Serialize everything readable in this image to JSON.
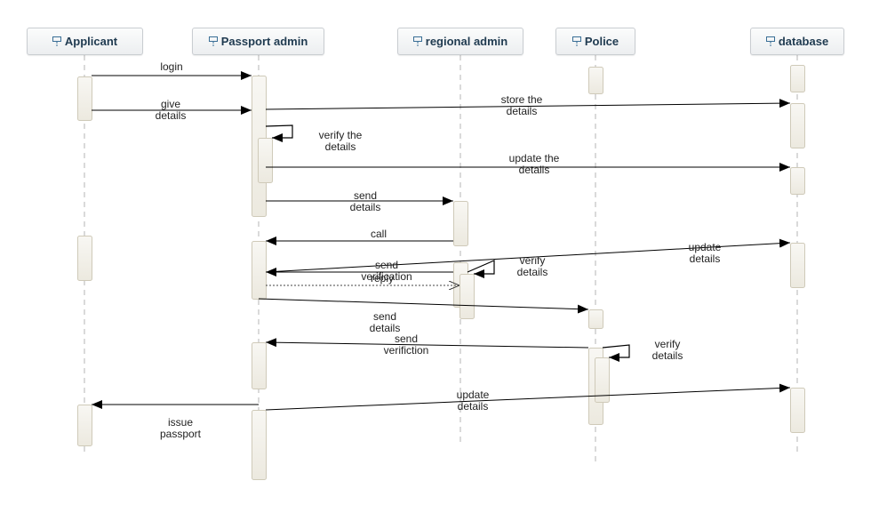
{
  "diagram": {
    "type": "sequence",
    "lifelines": [
      {
        "id": "applicant",
        "name": "Applicant"
      },
      {
        "id": "passport",
        "name": "Passport admin"
      },
      {
        "id": "regional",
        "name": "regional admin"
      },
      {
        "id": "police",
        "name": "Police"
      },
      {
        "id": "database",
        "name": "database"
      }
    ],
    "messages": [
      {
        "from": "applicant",
        "to": "passport",
        "label": "login",
        "kind": "sync"
      },
      {
        "from": "applicant",
        "to": "passport",
        "label": "give\ndetails",
        "kind": "sync"
      },
      {
        "from": "passport",
        "to": "database",
        "label": "store the\ndetails",
        "kind": "sync"
      },
      {
        "from": "passport",
        "to": "passport",
        "label": "verify the\ndetails",
        "kind": "self"
      },
      {
        "from": "passport",
        "to": "database",
        "label": "update the\ndetails",
        "kind": "sync"
      },
      {
        "from": "passport",
        "to": "regional",
        "label": "send\ndetails",
        "kind": "sync"
      },
      {
        "from": "regional",
        "to": "passport",
        "label": "call",
        "kind": "sync"
      },
      {
        "from": "regional",
        "to": "regional",
        "label": "verify\ndetails",
        "kind": "self"
      },
      {
        "from": "passport",
        "to": "database",
        "label": "update\ndetails",
        "kind": "sync"
      },
      {
        "from": "regional",
        "to": "passport",
        "label": "send\nverification",
        "kind": "sync"
      },
      {
        "from": "passport",
        "to": "regional",
        "label": "reply",
        "kind": "reply"
      },
      {
        "from": "passport",
        "to": "police",
        "label": "send\ndetails",
        "kind": "sync"
      },
      {
        "from": "police",
        "to": "passport",
        "label": "send\nverifiction",
        "kind": "sync"
      },
      {
        "from": "police",
        "to": "police",
        "label": "verify\ndetails",
        "kind": "self"
      },
      {
        "from": "passport",
        "to": "database",
        "label": "update\ndetails",
        "kind": "sync"
      },
      {
        "from": "passport",
        "to": "applicant",
        "label": "issue\npassport",
        "kind": "sync"
      }
    ]
  },
  "colors": {
    "header_text": "#1f3a50",
    "activation_fill": "#f3f1ea",
    "activation_border": "#cfcab9",
    "lifeline": "#b5b5b5",
    "arrow": "#000000"
  }
}
